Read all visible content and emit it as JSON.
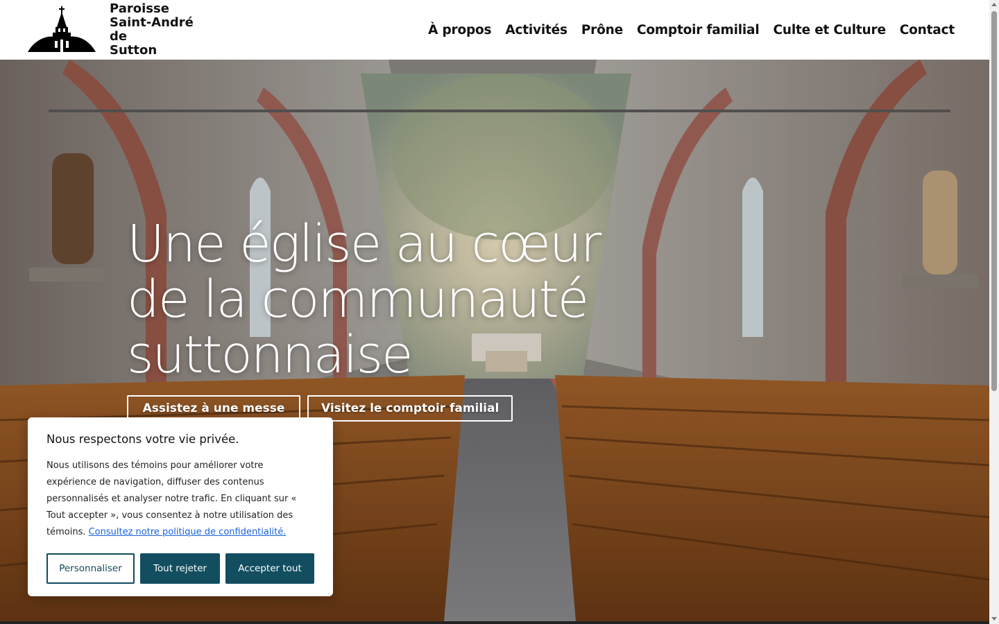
{
  "site": {
    "name_lines": [
      "Paroisse",
      "Saint-André de",
      "Sutton"
    ]
  },
  "nav": {
    "items": [
      "À propos",
      "Activités",
      "Prône",
      "Comptoir familial",
      "Culte et Culture",
      "Contact"
    ]
  },
  "hero": {
    "title_lines": [
      "Une église au cœur",
      "de la communauté",
      "suttonnaise"
    ],
    "buttons": [
      "Assistez à une messe",
      "Visitez le comptoir familial"
    ]
  },
  "cookie": {
    "title": "Nous respectons votre vie privée.",
    "text": "Nous utilisons des témoins pour améliorer votre expérience de navigation, diffuser des contenus personnalisés et analyser notre trafic. En cliquant sur « Tout accepter », vous consentez à notre utilisation des",
    "text_tail": "témoins.",
    "link": "Consultez notre politique de confidentialité.",
    "buttons": {
      "customize": "Personnaliser",
      "reject": "Tout rejeter",
      "accept": "Accepter tout"
    }
  },
  "colors": {
    "cookie_button": "#124e60",
    "link": "#1863dc"
  },
  "icons": {
    "logo": "church-steeple-icon"
  }
}
